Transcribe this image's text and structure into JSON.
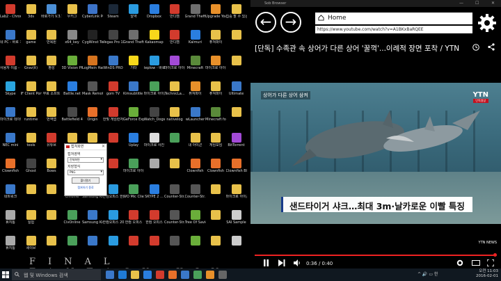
{
  "desktop": {
    "icons": [
      {
        "label": "Lab2 - Chrome",
        "color": "#d23b2d"
      },
      {
        "label": "3ds",
        "color": "#e8c14a"
      },
      {
        "label": "바로가기 V.3.7.5",
        "color": "#4b8fd6"
      },
      {
        "label": "우키그",
        "color": "#e8c14a"
      },
      {
        "label": "CyberLink PowerDirec...",
        "color": "#3c73c8"
      },
      {
        "label": "Steam",
        "color": "#1b2838"
      },
      {
        "label": "알약",
        "color": "#2a9be0"
      },
      {
        "label": "Dropbox",
        "color": "#2a7ee0"
      },
      {
        "label": "반디캠",
        "color": "#d23b2d"
      },
      {
        "label": "Grand Theft Auto V",
        "color": "#6e6e6e"
      },
      {
        "label": "Upgrade Your Life!",
        "color": "#e8902a"
      },
      {
        "label": "집중 할 수 있는",
        "color": "#e8c14a"
      },
      {
        "label": "네 PC - 바로 가기",
        "color": "#3a78c9"
      },
      {
        "label": "game",
        "color": "#e8c14a"
      },
      {
        "label": "반복된",
        "color": "#e8c14a"
      },
      {
        "label": "x64_key",
        "color": "#888"
      },
      {
        "label": "CygWinst Terminal",
        "color": "#222"
      },
      {
        "label": "Vegas Pro 13.0 (64-bit)",
        "color": "#444"
      },
      {
        "label": "Grand Theft Auto V",
        "color": "#6e6e6e"
      },
      {
        "label": "Kakaomap",
        "color": "#f7d81b"
      },
      {
        "label": "반디캠",
        "color": "#d23b2d"
      },
      {
        "label": "Kalmuri",
        "color": "#2a7ee0"
      },
      {
        "label": "퓨쳐파이",
        "color": "#e8c14a"
      },
      {
        "label": "",
        "color": "#e8c14a"
      },
      {
        "label": "사용자 이름 - Chrome",
        "color": "#d23b2d"
      },
      {
        "label": "Grav(it)",
        "color": "#e8c14a"
      },
      {
        "label": "평성",
        "color": "#e8c14a"
      },
      {
        "label": "3D Vision Photo Viewer",
        "color": "#6aae3a"
      },
      {
        "label": "LogMein Hamachi",
        "color": "#d6741f"
      },
      {
        "label": "WinDS PRO",
        "color": "#3a78c9"
      },
      {
        "label": "기타",
        "color": "#f7d81b"
      },
      {
        "label": "teplow - 바로 가기",
        "color": "#2a9be0"
      },
      {
        "label": "마이크로 아이콘...",
        "color": "#a24ad6"
      },
      {
        "label": "Minecraft",
        "color": "#5a8a3a"
      },
      {
        "label": "마이크로 아이콘",
        "color": "#e8902a"
      },
      {
        "label": "",
        "color": "#e8c14a"
      },
      {
        "label": "Skype",
        "color": "#2aa5e0"
      },
      {
        "label": "IF Client Portable",
        "color": "#e8c14a"
      },
      {
        "label": "무료 소프트",
        "color": "#e8c14a"
      },
      {
        "label": "Battle.net",
        "color": "#2a7ee0"
      },
      {
        "label": "Mask Remote",
        "color": "#555"
      },
      {
        "label": "gom TV",
        "color": "#d23b2d"
      },
      {
        "label": "Kimsubtitle 프로그램",
        "color": "#3a78c9"
      },
      {
        "label": "마이크로 아이콘",
        "color": "#4aa05a"
      },
      {
        "label": "TechnicLa...",
        "color": "#e8c14a"
      },
      {
        "label": "퓨쳐파이",
        "color": "#e8902a"
      },
      {
        "label": "퓨쳐파이",
        "color": "#e8c14a"
      },
      {
        "label": "Ultimate",
        "color": "#3a78c9"
      },
      {
        "label": "마이크로 데이터",
        "color": "#3a78c9"
      },
      {
        "label": "runtime",
        "color": "#e8c14a"
      },
      {
        "label": "번역앱",
        "color": "#e8c14a"
      },
      {
        "label": "Battlefield 4",
        "color": "#4a4a4a"
      },
      {
        "label": "Origin",
        "color": "#e8702a"
      },
      {
        "label": "한빛 게임런처",
        "color": "#d23b2d"
      },
      {
        "label": "GeForce Experience",
        "color": "#6aae3a"
      },
      {
        "label": "Watch_Dogs",
        "color": "#444"
      },
      {
        "label": "nativelog",
        "color": "#e8c14a"
      },
      {
        "label": "wLauncher",
        "color": "#3a78c9"
      },
      {
        "label": "Minecraft for Minec",
        "color": "#5a8a3a"
      },
      {
        "label": "",
        "color": "#e8c14a"
      },
      {
        "label": "NEC mini",
        "color": "#3a78c9"
      },
      {
        "label": "tools",
        "color": "#e8c14a"
      },
      {
        "label": "유튜브",
        "color": "#d23b2d"
      },
      {
        "label": "",
        "color": "#e8c14a"
      },
      {
        "label": "",
        "color": "#e8c14a"
      },
      {
        "label": "",
        "color": "#d23b2d"
      },
      {
        "label": "Uplay",
        "color": "#2a7ee0"
      },
      {
        "label": "마이크로 사진",
        "color": "#ddd"
      },
      {
        "label": "",
        "color": "#4aa05a"
      },
      {
        "label": "내 아이콘",
        "color": "#e8c14a"
      },
      {
        "label": "게임모임",
        "color": "#e8c14a"
      },
      {
        "label": "BitTorrent",
        "color": "#a24ad6"
      },
      {
        "label": "Clownfish",
        "color": "#e8702a"
      },
      {
        "label": "Ghost",
        "color": "#444"
      },
      {
        "label": "Bows",
        "color": "#e8c14a"
      },
      {
        "label": "",
        "color": "#e8c14a"
      },
      {
        "label": "",
        "color": "#e8c14a"
      },
      {
        "label": "",
        "color": "#d23b2d"
      },
      {
        "label": "마이크로 아이콘",
        "color": "#4aa05a"
      },
      {
        "label": "",
        "color": "#aaa"
      },
      {
        "label": "",
        "color": "#e8c14a"
      },
      {
        "label": "Clownfish",
        "color": "#e8702a"
      },
      {
        "label": "Clownfish",
        "color": "#e8702a"
      },
      {
        "label": "Clownfish Black Sea",
        "color": "#e8702a"
      },
      {
        "label": "네트워크",
        "color": "#3a78c9"
      },
      {
        "label": "",
        "color": "#e8c14a"
      },
      {
        "label": "",
        "color": "#e8c14a"
      },
      {
        "label": "Chrome",
        "color": "#d23b2d"
      },
      {
        "label": "Samsung Kies",
        "color": "#3a78c9"
      },
      {
        "label": "한컴오피스 한글 2014",
        "color": "#2a9be0"
      },
      {
        "label": "WO Mic Client",
        "color": "#4aa05a"
      },
      {
        "label": "SKYPE 2 ...",
        "color": "#2a7ee0"
      },
      {
        "label": "Counter-Str. Online 2",
        "color": "#555"
      },
      {
        "label": "Counter-Str. Online",
        "color": "#555"
      },
      {
        "label": "",
        "color": "#e8c14a"
      },
      {
        "label": "마이크로 아이콘",
        "color": "#e8c14a"
      },
      {
        "label": "휴지통",
        "color": "#aaa"
      },
      {
        "label": "실험",
        "color": "#e8c14a"
      },
      {
        "label": "",
        "color": "#e8c14a"
      },
      {
        "label": "CivOnline",
        "color": "#4aa05a"
      },
      {
        "label": "Samsung Kies (Lite)",
        "color": "#3a78c9"
      },
      {
        "label": "한컴오피스 2014",
        "color": "#2a9be0"
      },
      {
        "label": "한컴 오피스",
        "color": "#d23b2d"
      },
      {
        "label": "한컴 오피스",
        "color": "#d23b2d"
      },
      {
        "label": "Counter-Str. Online",
        "color": "#555"
      },
      {
        "label": "Tree Of Savior",
        "color": "#6aae3a"
      },
      {
        "label": "",
        "color": "#e8c14a"
      },
      {
        "label": "SAI Sample",
        "color": "#ccc"
      },
      {
        "label": "휴지통",
        "color": "#aaa"
      },
      {
        "label": "세이브",
        "color": "#e8c14a"
      },
      {
        "label": "",
        "color": "#e8c14a"
      },
      {
        "label": "",
        "color": "#4aa05a"
      },
      {
        "label": "",
        "color": "#3a78c9"
      },
      {
        "label": "",
        "color": "#2a9be0"
      },
      {
        "label": "",
        "color": "#d23b2d"
      },
      {
        "label": "",
        "color": "#d23b2d"
      },
      {
        "label": "",
        "color": "#555"
      },
      {
        "label": "",
        "color": "#6aae3a"
      },
      {
        "label": "",
        "color": "#e8c14a"
      },
      {
        "label": "",
        "color": "#ccc"
      }
    ],
    "overlay_text": "FINAL FANTASY XIV",
    "dialog": {
      "title": "캡쳐화면",
      "close": "✕",
      "label1": "캡쳐영역",
      "select1": "전체화면",
      "label2": "저장형식",
      "select2": "PNG",
      "open_button": "폴더열기",
      "link": "캡쳐하기 종료",
      "accent": "#c22"
    }
  },
  "browser": {
    "title": "Sob Browser",
    "window_controls": {
      "minimize": "—",
      "maximize": "☐",
      "close": "✕"
    },
    "nav": {
      "back": "←",
      "forward": "→"
    },
    "home_label": "Home",
    "url": "https://www.youtube.com/watch?v=A1BKxBaRQEE",
    "video_title": "[단독] 수족관 속 상어가 다른 상어 '꿀꺽'...이례적 장면 포착 / YTN",
    "video": {
      "subtitle_top": "상어가 다른 상어 삼켜",
      "logo": "YTN",
      "logo_sub": "단독영상",
      "caption": "샌드타이거 샤크…최대 3m·날카로운 이빨 특징",
      "small_logo": "YTN NEWS"
    },
    "player": {
      "time": "0:36 / 0:40",
      "progress_fraction": 0.99,
      "accent": "#e22"
    }
  },
  "taskbar": {
    "search_placeholder": "웹 및 Windows 검색",
    "tray": "^ 🔊 ▭ 한",
    "time": "오전 11:03",
    "date": "2016-02-01",
    "apps": [
      {
        "name": "task-view",
        "color": "#3a78c9"
      },
      {
        "name": "edge",
        "color": "#1f7bd6"
      },
      {
        "name": "explorer",
        "color": "#e8c14a"
      },
      {
        "name": "store",
        "color": "#2a7ee0"
      },
      {
        "name": "chrome",
        "color": "#d23b2d"
      },
      {
        "name": "media",
        "color": "#e8702a"
      },
      {
        "name": "app-blue",
        "color": "#3a78c9"
      },
      {
        "name": "app-green",
        "color": "#4aa05a"
      },
      {
        "name": "app-orange",
        "color": "#e8902a"
      },
      {
        "name": "app-gray",
        "color": "#666"
      }
    ]
  }
}
